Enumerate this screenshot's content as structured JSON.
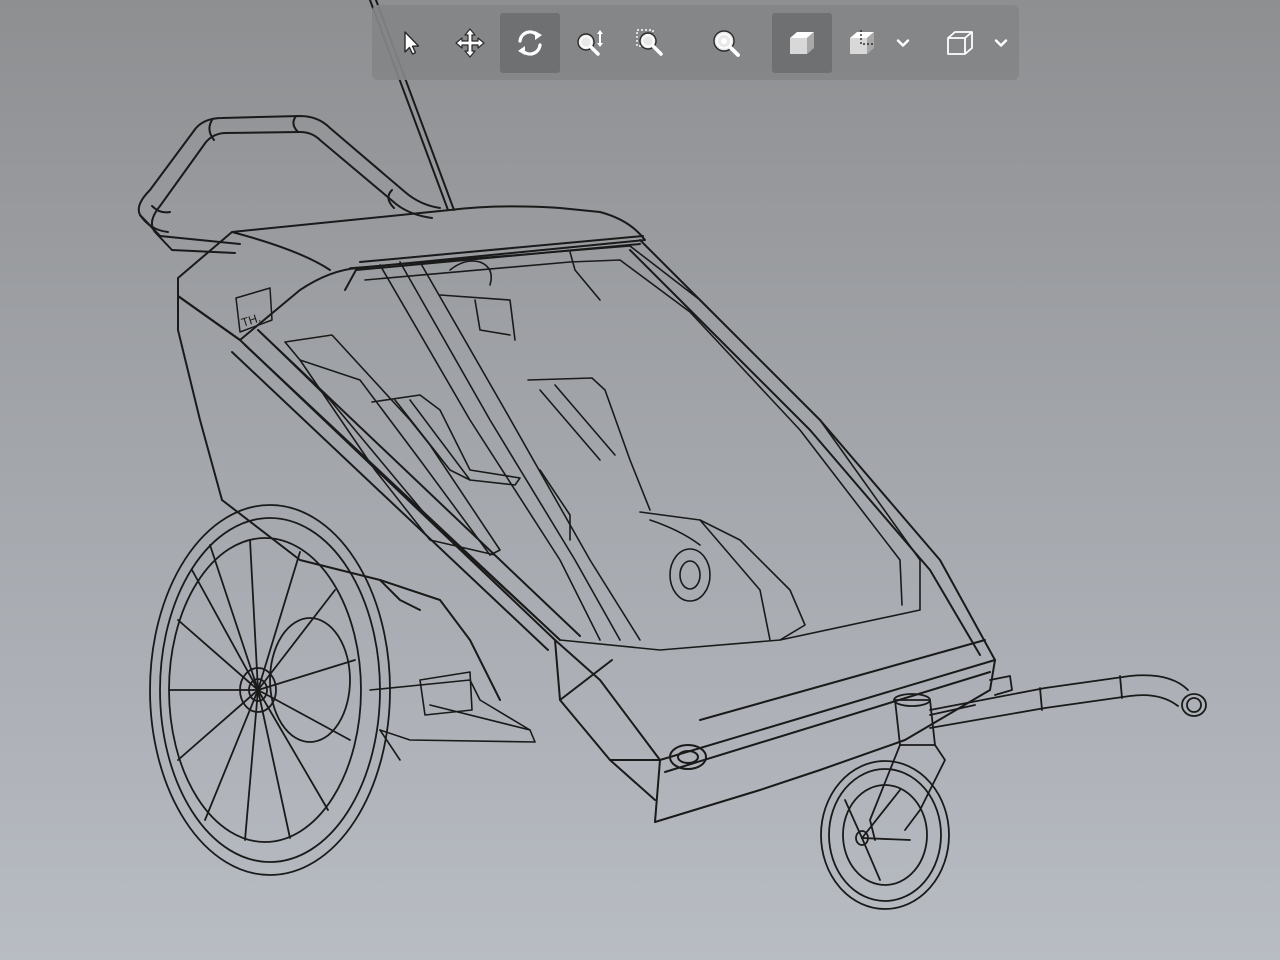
{
  "viewer": {
    "background_top": "#8e8f91",
    "background_bottom": "#b8bcc3",
    "model": "bike-trailer-stroller-wireframe",
    "model_badge_text": "TH."
  },
  "toolbar": {
    "tools": [
      {
        "id": "select",
        "icon": "cursor-arrow-icon",
        "active": false
      },
      {
        "id": "pan",
        "icon": "move-arrows-icon",
        "active": false
      },
      {
        "id": "orbit",
        "icon": "rotate-icon",
        "active": true
      },
      {
        "id": "zoom",
        "icon": "zoom-vertical-icon",
        "active": false
      },
      {
        "id": "zoom-window",
        "icon": "zoom-window-icon",
        "active": false
      },
      {
        "id": "zoom-fit",
        "icon": "zoom-fit-icon",
        "active": false
      },
      {
        "id": "shaded",
        "icon": "shaded-cube-icon",
        "active": true
      },
      {
        "id": "section",
        "icon": "section-cube-icon",
        "active": false,
        "has_dropdown": true
      },
      {
        "id": "view-orientation",
        "icon": "wireframe-cube-icon",
        "active": false,
        "has_dropdown": true
      }
    ]
  }
}
